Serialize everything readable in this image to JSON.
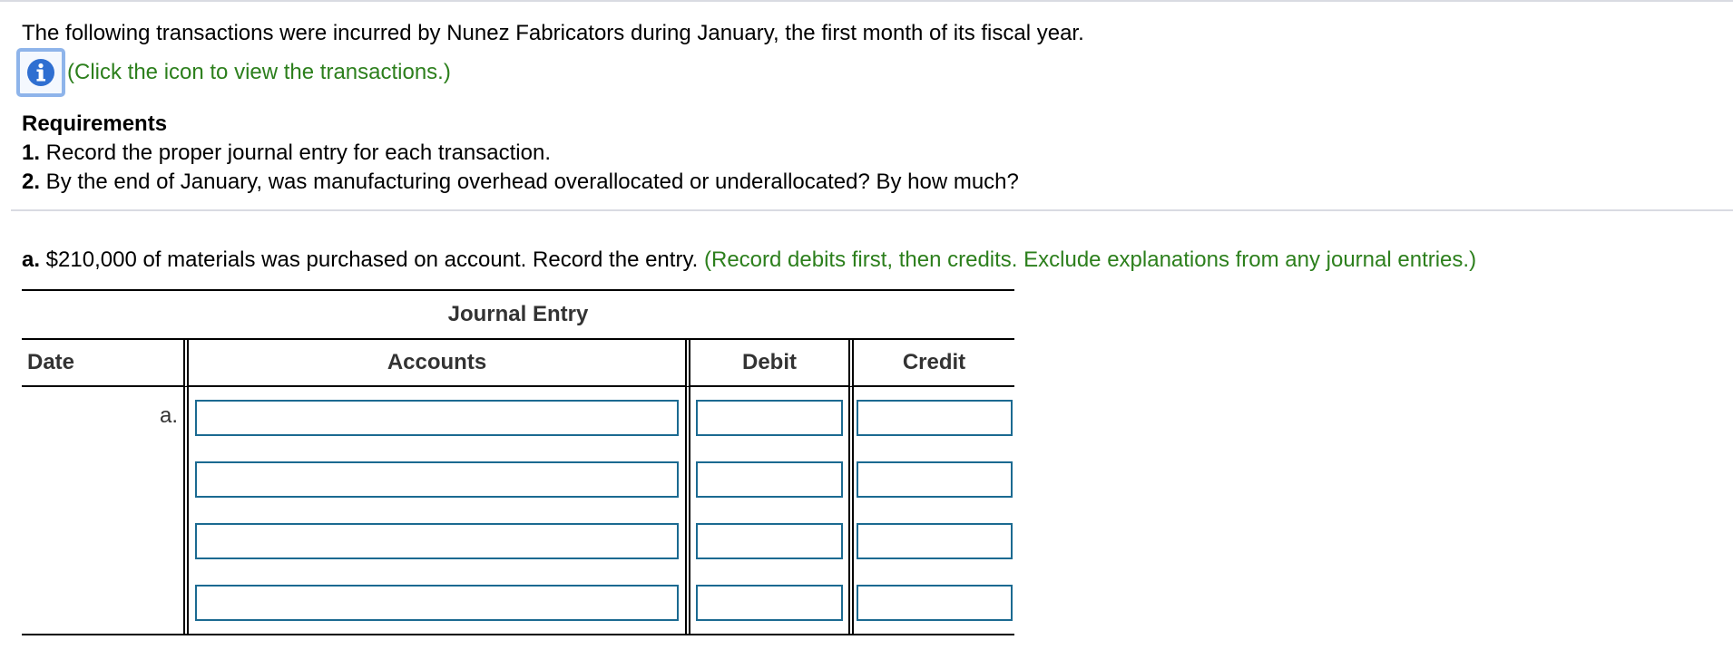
{
  "intro_text": "The following transactions were incurred by Nunez Fabricators during January, the first month of its fiscal year.",
  "info_link_text": "(Click the icon to view the transactions.)",
  "info_icon": "info-circle-icon",
  "requirements": {
    "title": "Requirements",
    "items": [
      {
        "num": "1.",
        "text": " Record the proper journal entry for each transaction."
      },
      {
        "num": "2.",
        "text": " By the end of January, was manufacturing overhead overallocated or underallocated? By how much?"
      }
    ]
  },
  "question": {
    "prefix": "a.",
    "text": " $210,000 of materials was purchased on account. Record the entry. ",
    "hint": "(Record debits first, then credits. Exclude explanations from any journal entries.)"
  },
  "journal": {
    "title": "Journal Entry",
    "headers": {
      "date": "Date",
      "accounts": "Accounts",
      "debit": "Debit",
      "credit": "Credit"
    },
    "rows": [
      {
        "date": "a.",
        "account": "",
        "debit": "",
        "credit": ""
      },
      {
        "date": "",
        "account": "",
        "debit": "",
        "credit": ""
      },
      {
        "date": "",
        "account": "",
        "debit": "",
        "credit": ""
      },
      {
        "date": "",
        "account": "",
        "debit": "",
        "credit": ""
      }
    ]
  },
  "colors": {
    "hint_green": "#2c7f1c",
    "input_border": "#1b6a91",
    "info_blue": "#2f6fd1",
    "info_focus": "#8eb4ea"
  }
}
